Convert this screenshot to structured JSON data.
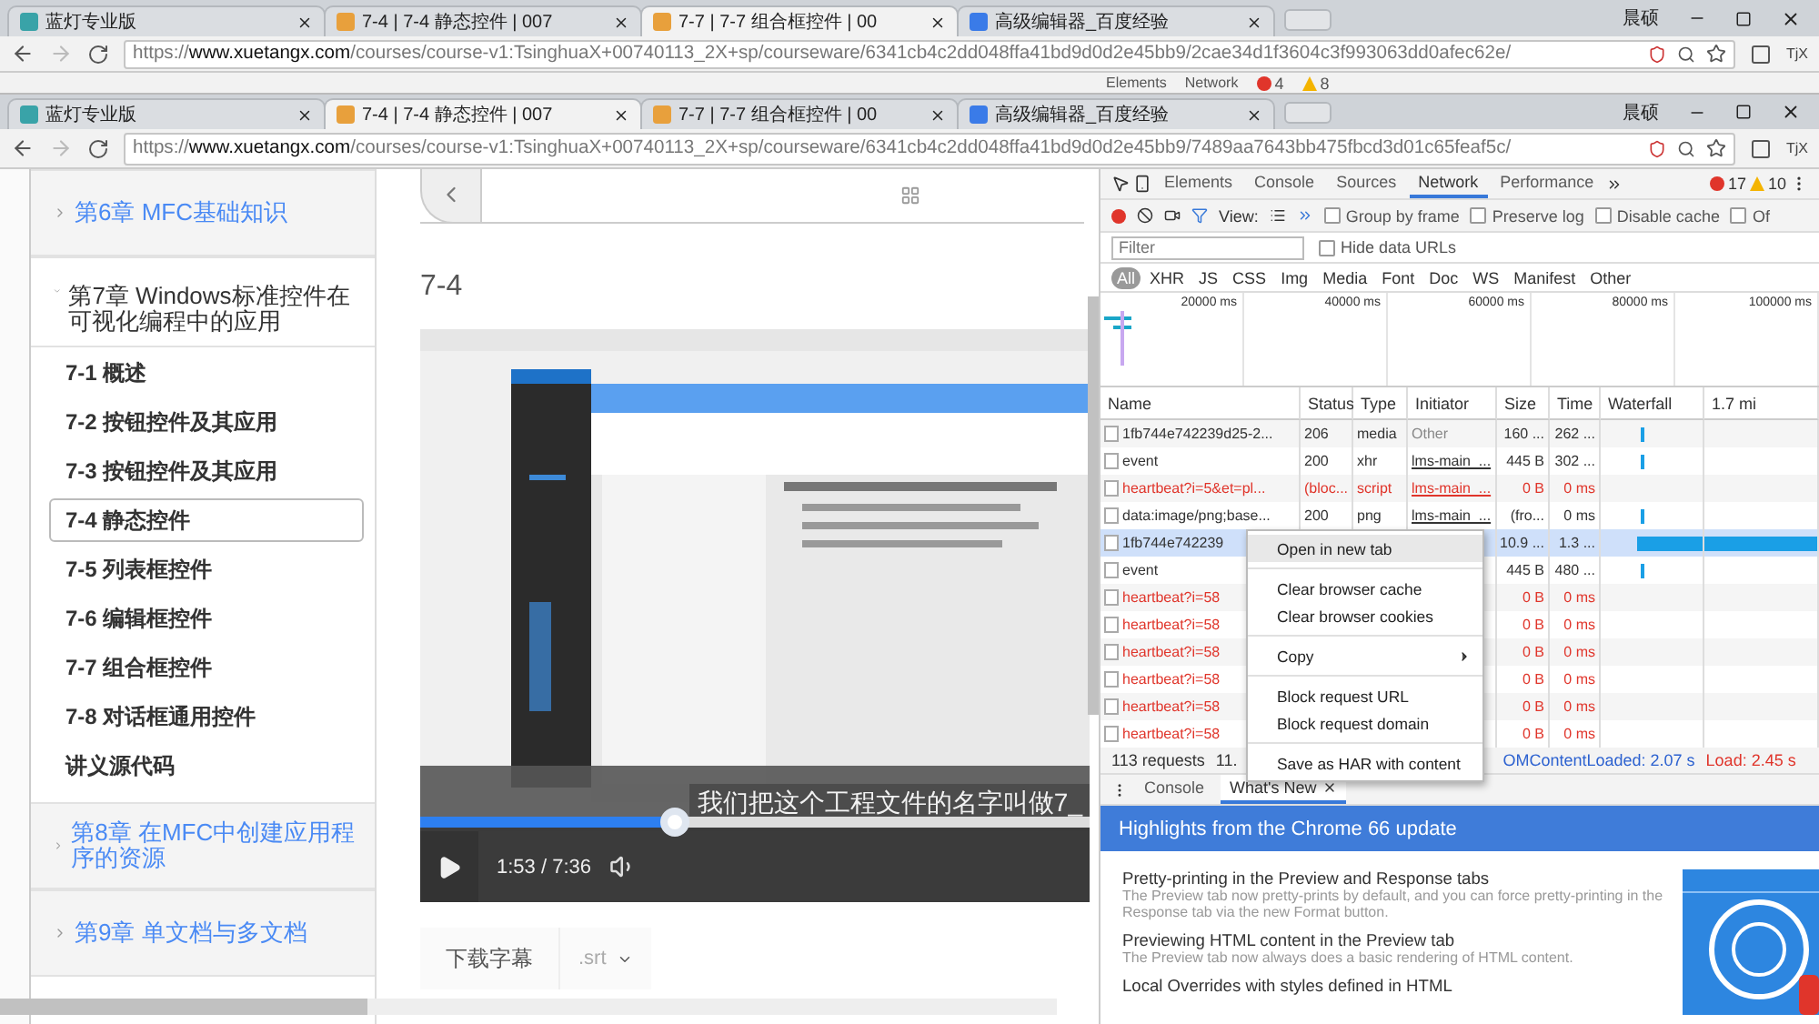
{
  "back_window": {
    "tabs": [
      {
        "label": "蓝灯专业版",
        "selected": false
      },
      {
        "label": "7-4 | 7-4 静态控件 | 007",
        "selected": false
      },
      {
        "label": "7-7 | 7-7 组合框控件 | 00",
        "selected": true
      },
      {
        "label": "高级编辑器_百度经验",
        "selected": false
      }
    ],
    "user": "晨硕",
    "url": "https://**www.xuetangx.com**/courses/course-v1:TsinghuaX+00740113_2X+sp/courseware/6341cb4c2dd048ffa41bd9d0d2e45bb9/2cae34d1f3604c3f993063dd0afec62e/",
    "extension_label": "TjX",
    "devtools_tabs": [
      "Elements",
      "Network"
    ],
    "errors": "4",
    "warnings": "8"
  },
  "front_window": {
    "tabs": [
      {
        "label": "蓝灯专业版",
        "selected": false
      },
      {
        "label": "7-4 | 7-4 静态控件 | 007",
        "selected": true
      },
      {
        "label": "7-7 | 7-7 组合框控件 | 00",
        "selected": false
      },
      {
        "label": "高级编辑器_百度经验",
        "selected": false
      }
    ],
    "user": "晨硕",
    "url": "https://**www.xuetangx.com**/courses/course-v1:TsinghuaX+00740113_2X+sp/courseware/6341cb4c2dd048ffa41bd9d0d2e45bb9/7489aa7643bb475fbcd3d01c65feaf5c/",
    "extension_label": "TjX"
  },
  "sidebar": {
    "chapters": [
      {
        "label": "第6章 MFC基础知识",
        "expanded": false
      },
      {
        "label": "第7章 Windows标准控件在可视化编程中的应用",
        "expanded": true,
        "children": [
          {
            "label": "7-1 概述",
            "selected": false
          },
          {
            "label": "7-2 按钮控件及其应用",
            "selected": false
          },
          {
            "label": "7-3 按钮控件及其应用",
            "selected": false
          },
          {
            "label": "7-4 静态控件",
            "selected": true
          },
          {
            "label": "7-5 列表框控件",
            "selected": false
          },
          {
            "label": "7-6 编辑框控件",
            "selected": false
          },
          {
            "label": "7-7 组合框控件",
            "selected": false
          },
          {
            "label": "7-8 对话框通用控件",
            "selected": false
          },
          {
            "label": "讲义源代码",
            "selected": false
          }
        ]
      },
      {
        "label": "第8章 在MFC中创建应用程序的资源",
        "expanded": false
      },
      {
        "label": "第9章 单文档与多文档",
        "expanded": false
      }
    ]
  },
  "content": {
    "title": "7-4",
    "video": {
      "kind": "picture",
      "caption": "我们把这个工程文件的名字叫做7_",
      "time": "1:53 / 7:36",
      "level": 0.38
    },
    "subtitle_button": "下载字幕",
    "subtitle_format": ".srt"
  },
  "devtools": {
    "tabs": [
      {
        "label": "Elements",
        "selected": false
      },
      {
        "label": "Console",
        "selected": false
      },
      {
        "label": "Sources",
        "selected": false
      },
      {
        "label": "Network",
        "selected": true
      },
      {
        "label": "Performance",
        "selected": false
      }
    ],
    "errors": "17",
    "warnings": "10",
    "view_label": "View:",
    "options": [
      {
        "label": "Group by frame",
        "checked": false
      },
      {
        "label": "Preserve log",
        "checked": false
      },
      {
        "label": "Disable cache",
        "checked": false
      },
      {
        "label": "Of",
        "checked": false
      }
    ],
    "filter": {
      "placeholder": "Filter"
    },
    "hide_data_urls": {
      "label": "Hide data URLs",
      "checked": false
    },
    "types": [
      {
        "label": "All",
        "selected": true
      },
      {
        "label": "XHR",
        "selected": false
      },
      {
        "label": "JS",
        "selected": false
      },
      {
        "label": "CSS",
        "selected": false
      },
      {
        "label": "Img",
        "selected": false
      },
      {
        "label": "Media",
        "selected": false
      },
      {
        "label": "Font",
        "selected": false
      },
      {
        "label": "Doc",
        "selected": false
      },
      {
        "label": "WS",
        "selected": false
      },
      {
        "label": "Manifest",
        "selected": false
      },
      {
        "label": "Other",
        "selected": false
      }
    ],
    "timeline_ticks": [
      "20000 ms",
      "40000 ms",
      "60000 ms",
      "80000 ms",
      "100000 ms"
    ],
    "columns": [
      "Name",
      "Status",
      "Type",
      "Initiator",
      "Size",
      "Time",
      "Waterfall",
      "1.7 mi"
    ],
    "requests": [
      {
        "name": "1fb744e742239d25-2...",
        "status": "206",
        "type": "media",
        "initiator": "Other",
        "size": "160 ...",
        "time": "262 ...",
        "error": false,
        "selected": false,
        "waterfall": {
          "kind": "tick"
        }
      },
      {
        "name": "event",
        "status": "200",
        "type": "xhr",
        "initiator": "lms-main_...",
        "size": "445 B",
        "time": "302 ...",
        "error": false,
        "selected": false,
        "waterfall": {
          "kind": "tick"
        }
      },
      {
        "name": "heartbeat?i=5&et=pl...",
        "status": "(bloc...",
        "type": "script",
        "initiator": "lms-main_...",
        "size": "0 B",
        "time": "0 ms",
        "error": true,
        "selected": false
      },
      {
        "name": "data:image/png;base...",
        "status": "200",
        "type": "png",
        "initiator": "lms-main_...",
        "size": "(fro...",
        "time": "0 ms",
        "error": false,
        "selected": false,
        "waterfall": {
          "kind": "tick"
        }
      },
      {
        "name": "1fb744e742239",
        "size": "10.9 ...",
        "time": "1.3 ...",
        "error": false,
        "selected": true,
        "waterfall": {
          "kind": "long"
        }
      },
      {
        "name": "event",
        "size": "445 B",
        "time": "480 ...",
        "error": false,
        "selected": false,
        "waterfall": {
          "kind": "tick"
        }
      },
      {
        "name": "heartbeat?i=58",
        "size": "0 B",
        "time": "0 ms",
        "error": true,
        "selected": false
      },
      {
        "name": "heartbeat?i=58",
        "size": "0 B",
        "time": "0 ms",
        "error": true,
        "selected": false
      },
      {
        "name": "heartbeat?i=58",
        "size": "0 B",
        "time": "0 ms",
        "error": true,
        "selected": false
      },
      {
        "name": "heartbeat?i=58",
        "size": "0 B",
        "time": "0 ms",
        "error": true,
        "selected": false
      },
      {
        "name": "heartbeat?i=58",
        "size": "0 B",
        "time": "0 ms",
        "error": true,
        "selected": false
      },
      {
        "name": "heartbeat?i=58",
        "size": "0 B",
        "time": "0 ms",
        "error": true,
        "selected": false
      }
    ],
    "status_bar": {
      "requests": "113 requests",
      "transferred": "11.",
      "dom_loaded": "OMContentLoaded: 2.07 s",
      "load": "Load: 2.45 s"
    },
    "context_menu": [
      {
        "kind": "item",
        "label": "Open in new tab",
        "selected": true
      },
      {
        "kind": "separator"
      },
      {
        "kind": "item",
        "label": "Clear browser cache",
        "selected": false
      },
      {
        "kind": "item",
        "label": "Clear browser cookies",
        "selected": false
      },
      {
        "kind": "separator"
      },
      {
        "kind": "submenu",
        "label": "Copy",
        "selected": false
      },
      {
        "kind": "separator"
      },
      {
        "kind": "item",
        "label": "Block request URL",
        "selected": false
      },
      {
        "kind": "item",
        "label": "Block request domain",
        "selected": false
      },
      {
        "kind": "separator"
      },
      {
        "kind": "item",
        "label": "Save as HAR with content",
        "selected": false
      }
    ],
    "drawer_tabs": [
      {
        "label": "Console",
        "selected": false
      },
      {
        "label": "What's New",
        "selected": true
      }
    ],
    "whats_new": {
      "banner": "Highlights from the Chrome 66 update",
      "items": [
        {
          "title": "Pretty-printing in the Preview and Response tabs",
          "text": "The Preview tab now pretty-prints by default, and you can force pretty-printing in the Response tab via the new Format button."
        },
        {
          "title": "Previewing HTML content in the Preview tab",
          "text": "The Preview tab now always does a basic rendering of HTML content."
        },
        {
          "title": "Local Overrides with styles defined in HTML"
        }
      ]
    }
  }
}
